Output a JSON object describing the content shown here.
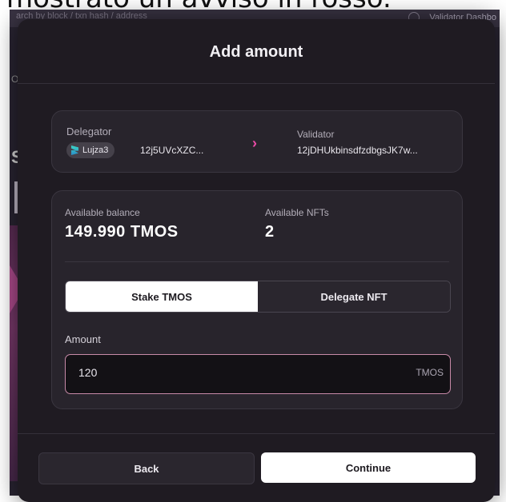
{
  "caption": "mostrato un avviso in rosso.",
  "backdrop": {
    "search_text": "arch by block / txn hash / address",
    "dashboard_text": "Validator Dashbo",
    "side_letter": "S",
    "side_small": "O"
  },
  "modal": {
    "title": "Add amount",
    "delegator_label": "Delegator",
    "delegator_name": "Lujza3",
    "delegator_address": "12j5UVcXZC...",
    "validator_label": "Validator",
    "validator_address": "12jDHUkbinsdfzdbgsJK7w...",
    "arrow_glyph": "›",
    "available_balance_label": "Available balance",
    "available_balance_value": "149.990 TMOS",
    "available_nfts_label": "Available NFTs",
    "available_nfts_value": "2",
    "tabs": [
      {
        "label": "Stake TMOS",
        "active": true
      },
      {
        "label": "Delegate NFT",
        "active": false
      }
    ],
    "amount_label": "Amount",
    "amount_value": "120",
    "amount_unit": "TMOS",
    "back_label": "Back",
    "continue_label": "Continue"
  },
  "colors": {
    "accent_arrow": "#ec4ba8",
    "modal_bg": "#1f1b22",
    "input_border": "#c88aa8"
  },
  "icons": {
    "delegator_chip_logo": "token-logo-icon",
    "route_arrow": "chevron-right-icon",
    "backdrop_user": "user-icon"
  }
}
